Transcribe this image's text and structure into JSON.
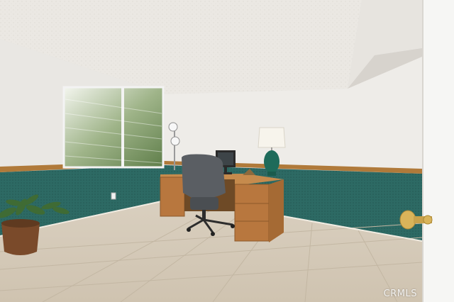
{
  "photo": {
    "watermark": "CRMLS",
    "palette": {
      "ceiling": "#ece9e4",
      "wall": "#eceae6",
      "wainscot": "#2c6560",
      "trim": "#b07a3a",
      "floor": "#d8cdbb",
      "desk": "#b8773e",
      "lamp_base": "#1e6b5a"
    }
  }
}
